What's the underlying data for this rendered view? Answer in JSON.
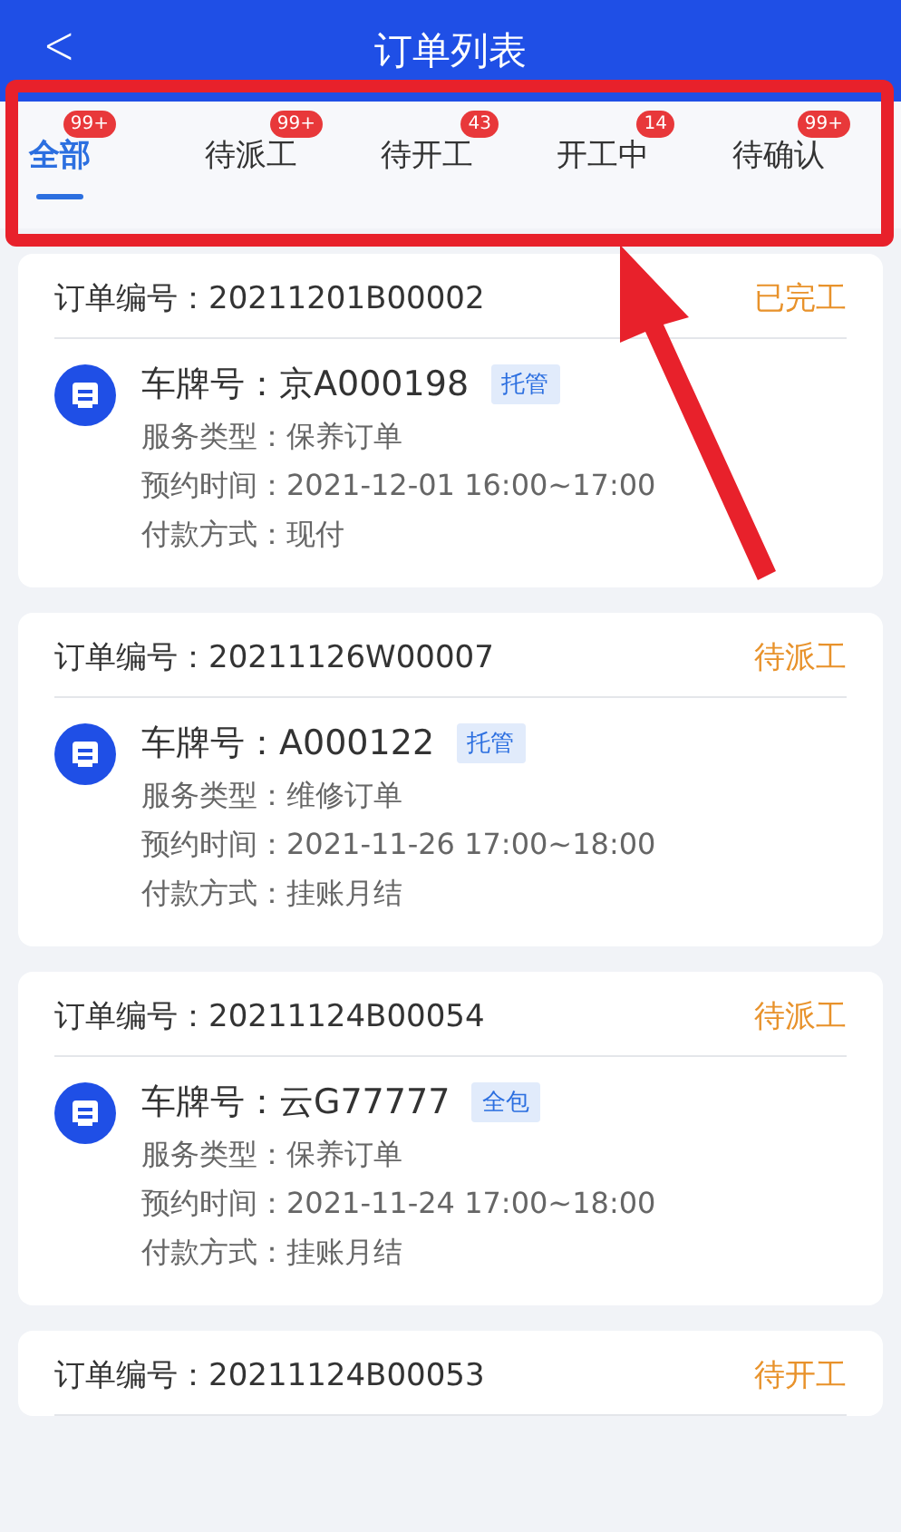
{
  "header": {
    "back_glyph": "<",
    "title": "订单列表"
  },
  "tabs": [
    {
      "label": "全部",
      "badge": "99+",
      "selected": true
    },
    {
      "label": "待派工",
      "badge": "99+",
      "selected": false
    },
    {
      "label": "待开工",
      "badge": "43",
      "selected": false
    },
    {
      "label": "开工中",
      "badge": "14",
      "selected": false
    },
    {
      "label": "待确认",
      "badge": "99+",
      "selected": false
    }
  ],
  "orders": [
    {
      "order_label": "订单编号：",
      "order_no": "20211201B00002",
      "status": "已完工",
      "plate_label": "车牌号：",
      "plate": "京A000198",
      "tag": "托管",
      "details": [
        {
          "label": "服务类型：",
          "value": "保养订单"
        },
        {
          "label": "预约时间：",
          "value": "2021-12-01 16:00~17:00"
        },
        {
          "label": "付款方式：",
          "value": "现付"
        }
      ]
    },
    {
      "order_label": "订单编号：",
      "order_no": "20211126W00007",
      "status": "待派工",
      "plate_label": "车牌号：",
      "plate": "A000122",
      "tag": "托管",
      "details": [
        {
          "label": "服务类型：",
          "value": "维修订单"
        },
        {
          "label": "预约时间：",
          "value": "2021-11-26 17:00~18:00"
        },
        {
          "label": "付款方式：",
          "value": "挂账月结"
        }
      ]
    },
    {
      "order_label": "订单编号：",
      "order_no": "20211124B00054",
      "status": "待派工",
      "plate_label": "车牌号：",
      "plate": "云G77777",
      "tag": "全包",
      "details": [
        {
          "label": "服务类型：",
          "value": "保养订单"
        },
        {
          "label": "预约时间：",
          "value": "2021-11-24 17:00~18:00"
        },
        {
          "label": "付款方式：",
          "value": "挂账月结"
        }
      ]
    },
    {
      "order_label": "订单编号：",
      "order_no": "20211124B00053",
      "status": "待开工"
    }
  ],
  "annotation": {
    "kind": "highlight_arrow"
  }
}
